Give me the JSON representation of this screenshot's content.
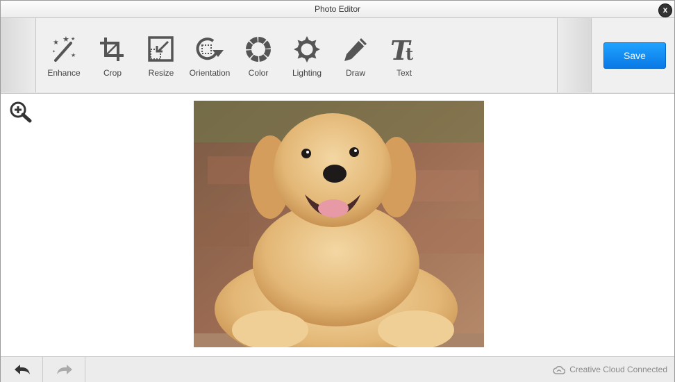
{
  "window": {
    "title": "Photo Editor",
    "close_label": "x"
  },
  "toolbar": {
    "tools": [
      {
        "label": "Enhance",
        "icon": "magic-wand-icon"
      },
      {
        "label": "Crop",
        "icon": "crop-icon"
      },
      {
        "label": "Resize",
        "icon": "resize-icon"
      },
      {
        "label": "Orientation",
        "icon": "rotate-icon"
      },
      {
        "label": "Color",
        "icon": "color-wheel-icon"
      },
      {
        "label": "Lighting",
        "icon": "sun-icon"
      },
      {
        "label": "Draw",
        "icon": "pencil-icon"
      },
      {
        "label": "Text",
        "icon": "text-icon"
      }
    ],
    "save_label": "Save",
    "save_color": "#0a8af5"
  },
  "canvas": {
    "zoom_icon": "zoom-in-icon",
    "image_subject": "golden retriever puppy"
  },
  "footer": {
    "undo_icon": "undo-icon",
    "redo_icon": "redo-icon",
    "status": "Creative Cloud Connected",
    "status_icon": "creative-cloud-icon"
  }
}
